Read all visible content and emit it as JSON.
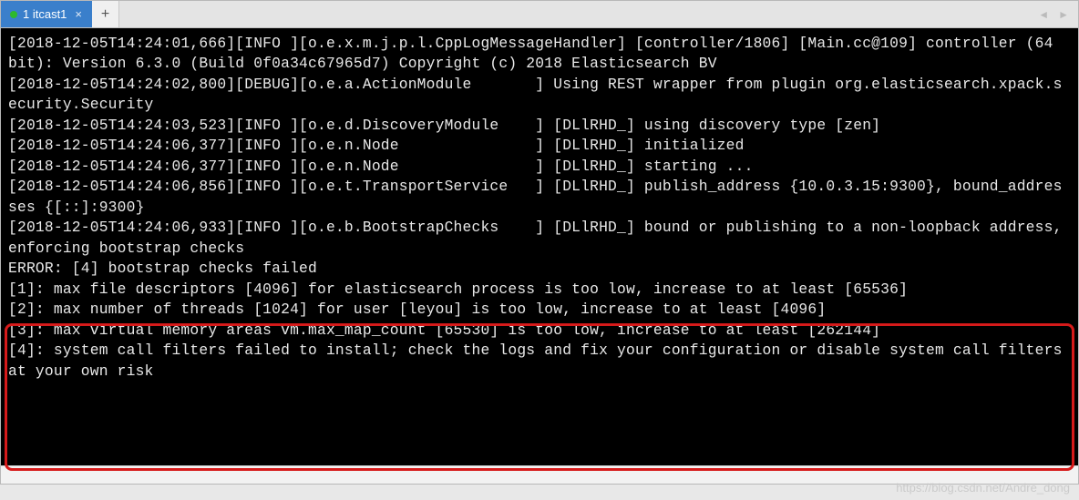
{
  "tabbar": {
    "tab_label": "1 itcast1",
    "active_dot": "green",
    "close_glyph": "×",
    "newtab_glyph": "+",
    "nav_left": "◄",
    "nav_right": "►"
  },
  "terminal": {
    "lines": [
      "[2018-12-05T14:24:01,666][INFO ][o.e.x.m.j.p.l.CppLogMessageHandler] [controller/1806] [Main.cc@109] controller (64 bit): Version 6.3.0 (Build 0f0a34c67965d7) Copyright (c) 2018 Elasticsearch BV",
      "[2018-12-05T14:24:02,800][DEBUG][o.e.a.ActionModule       ] Using REST wrapper from plugin org.elasticsearch.xpack.security.Security",
      "[2018-12-05T14:24:03,523][INFO ][o.e.d.DiscoveryModule    ] [DLlRHD_] using discovery type [zen]",
      "[2018-12-05T14:24:06,377][INFO ][o.e.n.Node               ] [DLlRHD_] initialized",
      "[2018-12-05T14:24:06,377][INFO ][o.e.n.Node               ] [DLlRHD_] starting ...",
      "[2018-12-05T14:24:06,856][INFO ][o.e.t.TransportService   ] [DLlRHD_] publish_address {10.0.3.15:9300}, bound_addresses {[::]:9300}",
      "[2018-12-05T14:24:06,933][INFO ][o.e.b.BootstrapChecks    ] [DLlRHD_] bound or publishing to a non-loopback address, enforcing bootstrap checks",
      "ERROR: [4] bootstrap checks failed",
      "[1]: max file descriptors [4096] for elasticsearch process is too low, increase to at least [65536]",
      "[2]: max number of threads [1024] for user [leyou] is too low, increase to at least [4096]",
      "[3]: max virtual memory areas vm.max_map_count [65530] is too low, increase to at least [262144]",
      "[4]: system call filters failed to install; check the logs and fix your configuration or disable system call filters at your own risk"
    ]
  },
  "watermark": "https://blog.csdn.net/Andre_dong"
}
